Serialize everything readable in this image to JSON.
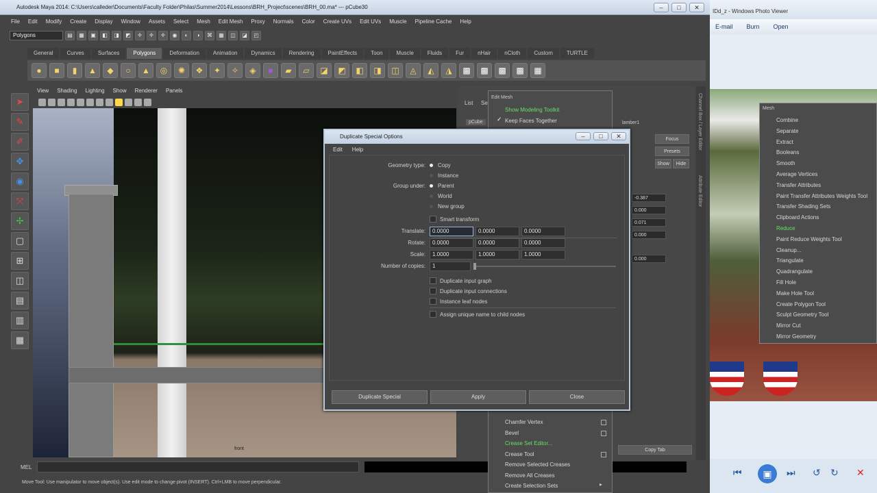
{
  "maya": {
    "title": "Autodesk Maya 2014: C:\\Users\\calleder\\Documents\\Faculty Folder\\Philas\\Summer2014\\Lessons\\BRH_Project\\scenes\\BRH_00.ma* --- pCube30",
    "menus": [
      "File",
      "Edit",
      "Modify",
      "Create",
      "Display",
      "Window",
      "Assets",
      "Select",
      "Mesh",
      "Edit Mesh",
      "Proxy",
      "Normals",
      "Color",
      "Create UVs",
      "Edit UVs",
      "Muscle",
      "Pipeline Cache",
      "Help"
    ],
    "mode": "Polygons",
    "shelf_tabs": [
      "General",
      "Curves",
      "Surfaces",
      "Polygons",
      "Deformation",
      "Animation",
      "Dynamics",
      "Rendering",
      "PaintEffects",
      "Toon",
      "Muscle",
      "Fluids",
      "Fur",
      "nHair",
      "nCloth",
      "Custom",
      "TURTLE"
    ],
    "active_shelf_tab": "Polygons",
    "viewport_menus": [
      "View",
      "Shading",
      "Lighting",
      "Show",
      "Renderer",
      "Panels"
    ],
    "viewport_label": "front",
    "mel_label": "MEL",
    "help_line": "Move Tool: Use manipulator to move object(s). Use edit mode to change pivot (INSERT). Ctrl+LMB to move perpendicular.",
    "channel_box": {
      "tabs": [
        "List",
        "Se"
      ],
      "object": "pCube",
      "node": "lamber1",
      "buttons": [
        "Focus",
        "Presets",
        "Show",
        "Hide"
      ],
      "values": [
        "-0.387",
        "0.000",
        "0.071",
        "0.000",
        "0.000"
      ],
      "copy_tab": "Copy Tab",
      "side_labels": [
        "Channel Box / Layer Editor",
        "Attribute Editor"
      ]
    }
  },
  "edit_mesh_menu": {
    "title": "Edit Mesh",
    "top_items": [
      {
        "label": "Show Modeling Toolkit",
        "green": true
      },
      {
        "label": "Keep Faces Together",
        "check": true
      }
    ],
    "bottom_items": [
      {
        "label": "Chamfer Vertex",
        "box": true
      },
      {
        "label": "Bevel",
        "box": true
      },
      {
        "label": "Crease Set Editor...",
        "green": true
      },
      {
        "label": "Crease Tool",
        "box": true
      },
      {
        "label": "Remove Selected Creases"
      },
      {
        "label": "Remove All Creases"
      },
      {
        "label": "Create Selection Sets",
        "arrow": true
      }
    ]
  },
  "dialog": {
    "title": "Duplicate Special Options",
    "menus": [
      "Edit",
      "Help"
    ],
    "geometry_type_label": "Geometry type:",
    "geometry_options": [
      "Copy",
      "Instance"
    ],
    "group_under_label": "Group under:",
    "group_options": [
      "Parent",
      "World",
      "New group"
    ],
    "smart_transform": "Smart transform",
    "translate_label": "Translate:",
    "translate": [
      "0.0000",
      "0.0000",
      "0.0000"
    ],
    "rotate_label": "Rotate:",
    "rotate": [
      "0.0000",
      "0.0000",
      "0.0000"
    ],
    "scale_label": "Scale:",
    "scale": [
      "1.0000",
      "1.0000",
      "1.0000"
    ],
    "copies_label": "Number of copies:",
    "copies": "1",
    "checks": [
      "Duplicate input graph",
      "Duplicate input connections",
      "Instance leaf nodes"
    ],
    "assign_unique": "Assign unique name to child nodes",
    "buttons": [
      "Duplicate Special",
      "Apply",
      "Close"
    ]
  },
  "photo_viewer": {
    "title": "IDd_z - Windows Photo Viewer",
    "toolbar": [
      "E-mail",
      "Burn",
      "Open"
    ],
    "menu_title": "Mesh",
    "menu_items": [
      {
        "label": "Combine"
      },
      {
        "label": "Separate"
      },
      {
        "label": "Extract"
      },
      {
        "label": "Booleans"
      },
      {
        "label": "Smooth"
      },
      {
        "label": "Average Vertices"
      },
      {
        "label": "Transfer Attributes"
      },
      {
        "label": "Paint Transfer Attributes Weights Tool"
      },
      {
        "label": "Transfer Shading Sets"
      },
      {
        "label": "Clipboard Actions"
      },
      {
        "label": "Reduce",
        "green": true
      },
      {
        "label": "Paint Reduce Weights Tool"
      },
      {
        "label": "Cleanup..."
      },
      {
        "label": "Triangulate"
      },
      {
        "label": "Quadrangulate"
      },
      {
        "label": "Fill Hole"
      },
      {
        "label": "Make Hole Tool"
      },
      {
        "label": "Create Polygon Tool"
      },
      {
        "label": "Sculpt Geometry Tool"
      },
      {
        "label": "Mirror Cut"
      },
      {
        "label": "Mirror Geometry"
      }
    ]
  }
}
